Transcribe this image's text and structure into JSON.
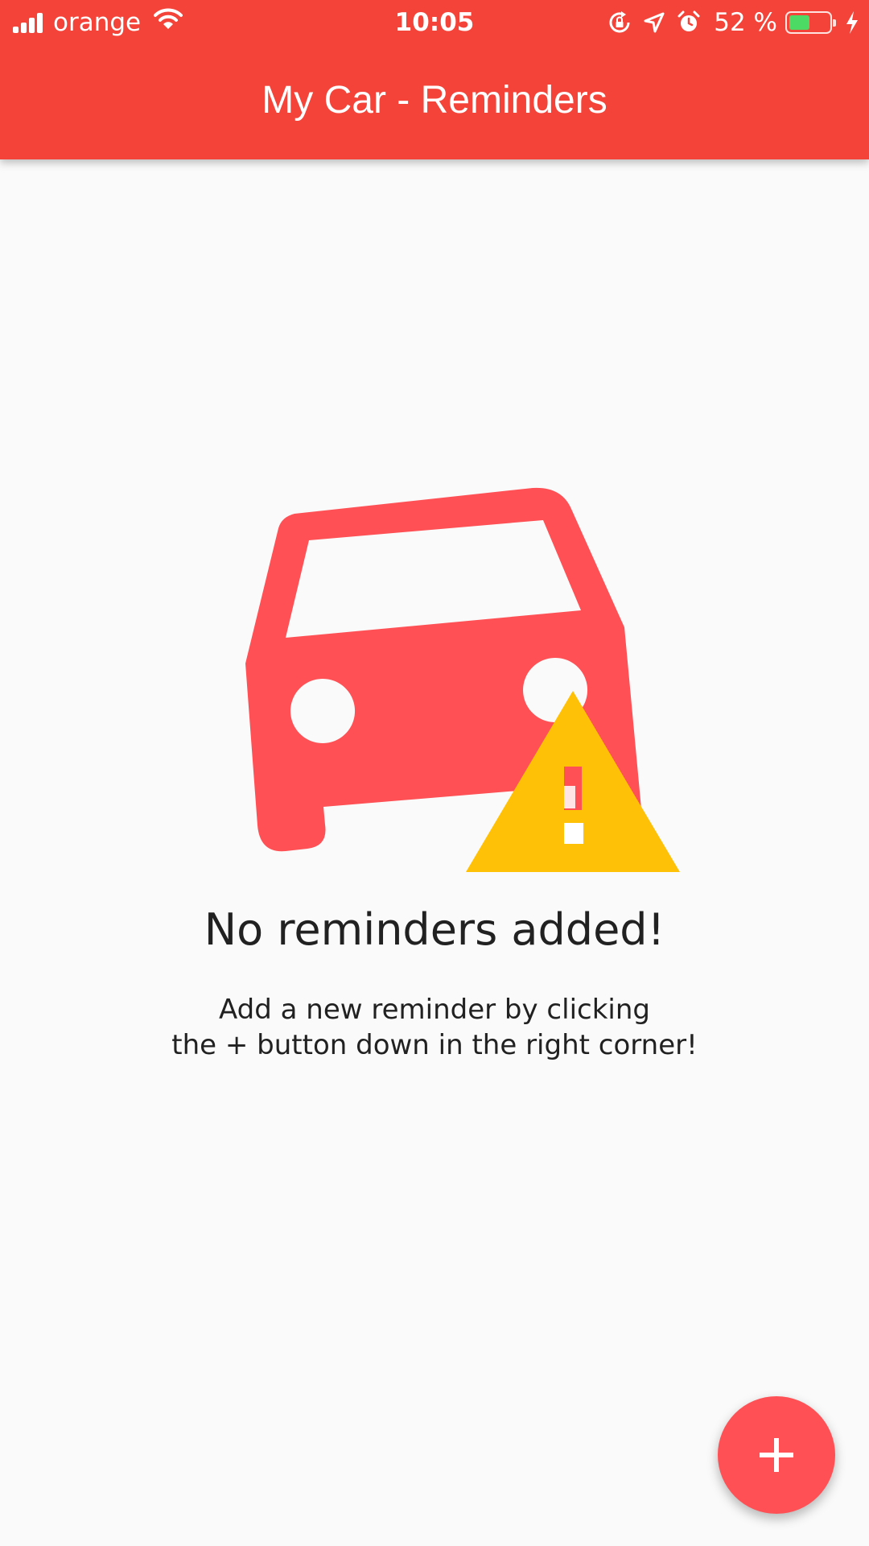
{
  "status_bar": {
    "carrier": "orange",
    "time": "10:05",
    "battery_percent": "52 %",
    "battery_level": 0.52,
    "icons": [
      "signal-icon",
      "wifi-icon",
      "rotation-lock-icon",
      "location-icon",
      "alarm-icon",
      "battery-icon",
      "charging-icon"
    ]
  },
  "app_bar": {
    "title": "My Car - Reminders",
    "background_color": "#f4443a"
  },
  "empty_state": {
    "illustration_icons": [
      "car-icon",
      "warning-icon"
    ],
    "car_color": "#ff5155",
    "warning_color": "#ffc107",
    "title": "No reminders added!",
    "message_line1": "Add a new reminder by clicking",
    "message_line2": "the + button down in the right corner!"
  },
  "fab": {
    "icon": "plus-icon",
    "color": "#ff5155"
  }
}
